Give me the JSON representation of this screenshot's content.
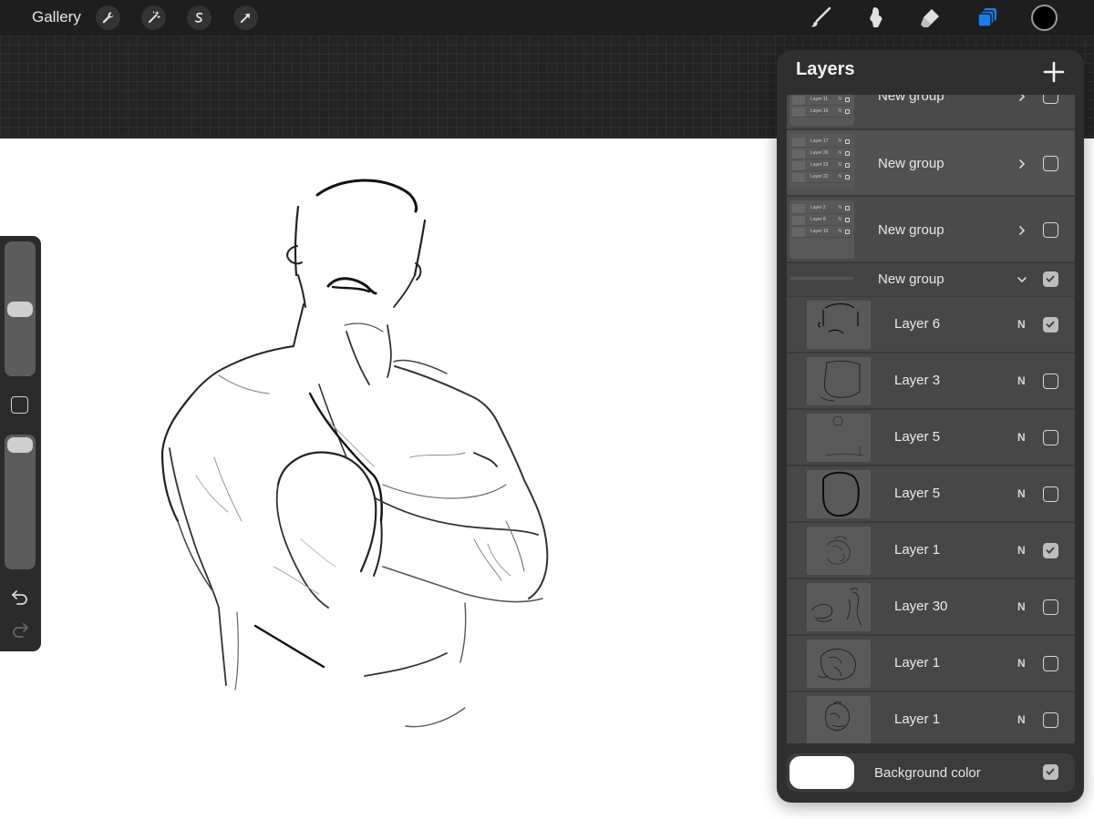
{
  "topbar": {
    "gallery_label": "Gallery",
    "left_tools": [
      "wrench-icon",
      "magic-wand-icon",
      "selection-icon",
      "transform-arrow-icon"
    ],
    "right_tools": [
      "brush-icon",
      "smudge-icon",
      "eraser-icon",
      "layers-icon"
    ],
    "active_tool": "layers-icon",
    "active_tool_color": "#1a7cf0",
    "current_color": "#000000"
  },
  "sidebar": {
    "brush_size_level": 0.5,
    "opacity_level": 1.0,
    "icons": [
      "modify-square-icon",
      "undo-icon",
      "redo-icon"
    ]
  },
  "layers_panel": {
    "title": "Layers",
    "add_icon": "plus-icon",
    "groups": [
      {
        "name": "New group",
        "expanded": false,
        "visible": false,
        "mini_layers": [
          "Layer 11",
          "Layer 16"
        ]
      },
      {
        "name": "New group",
        "expanded": false,
        "visible": false,
        "mini_layers": [
          "Layer 17",
          "Layer 26",
          "Layer 23",
          "Layer 22"
        ]
      },
      {
        "name": "New group",
        "expanded": false,
        "visible": false,
        "mini_layers": [
          "Layer 2",
          "Layer 8",
          "Layer 10"
        ]
      },
      {
        "name": "New group",
        "expanded": true,
        "visible": true,
        "mini_layers": []
      }
    ],
    "layers": [
      {
        "name": "Layer 6",
        "blend": "N",
        "visible": true
      },
      {
        "name": "Layer 3",
        "blend": "N",
        "visible": false
      },
      {
        "name": "Layer 5",
        "blend": "N",
        "visible": false
      },
      {
        "name": "Layer 5",
        "blend": "N",
        "visible": false
      },
      {
        "name": "Layer 1",
        "blend": "N",
        "visible": true
      },
      {
        "name": "Layer 30",
        "blend": "N",
        "visible": false
      },
      {
        "name": "Layer 1",
        "blend": "N",
        "visible": false
      },
      {
        "name": "Layer 1",
        "blend": "N",
        "visible": false
      }
    ],
    "background": {
      "label": "Background color",
      "color": "#ffffff",
      "visible": true
    }
  }
}
